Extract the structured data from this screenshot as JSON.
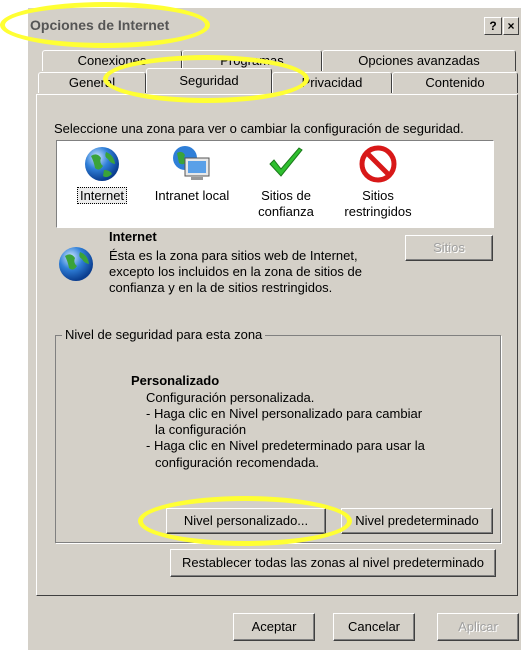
{
  "window": {
    "title": "Opciones de Internet",
    "help_glyph": "?",
    "close_glyph": "×"
  },
  "tabs": {
    "row1": [
      "Conexiones",
      "Programas",
      "Opciones avanzadas"
    ],
    "row2": [
      "General",
      "Seguridad",
      "Privacidad",
      "Contenido"
    ]
  },
  "zones": {
    "instruction": "Seleccione una zona para ver o cambiar la configuración de seguridad.",
    "items": [
      {
        "label": "Internet",
        "icon": "globe-icon"
      },
      {
        "label": "Intranet local",
        "icon": "intranet-monitor-icon"
      },
      {
        "label": "Sitios de confianza",
        "icon": "checkmark-icon"
      },
      {
        "label": "Sitios restringidos",
        "icon": "forbidden-icon"
      }
    ],
    "selected": "Internet"
  },
  "zone_info": {
    "title": "Internet",
    "description": "Ésta es la zona para sitios web de Internet, excepto los incluidos en la zona de sitios de confianza y en la de sitios restringidos.",
    "sites_button": "Sitios"
  },
  "security_level": {
    "legend": "Nivel de seguridad para esta zona",
    "title": "Personalizado",
    "line1": "Configuración personalizada.",
    "line2": "- Haga clic en Nivel personalizado para cambiar",
    "line3": "la configuración",
    "line4": "- Haga clic en Nivel predeterminado para usar la",
    "line5": "configuración recomendada.",
    "custom_button": "Nivel personalizado...",
    "default_button": "Nivel predeterminado"
  },
  "reset_button": "Restablecer todas las zonas al nivel predeterminado",
  "footer": {
    "accept": "Aceptar",
    "cancel": "Cancelar",
    "apply": "Aplicar"
  },
  "colors": {
    "face": "#d4d0c8",
    "highlight_annotation": "#ffff33"
  }
}
